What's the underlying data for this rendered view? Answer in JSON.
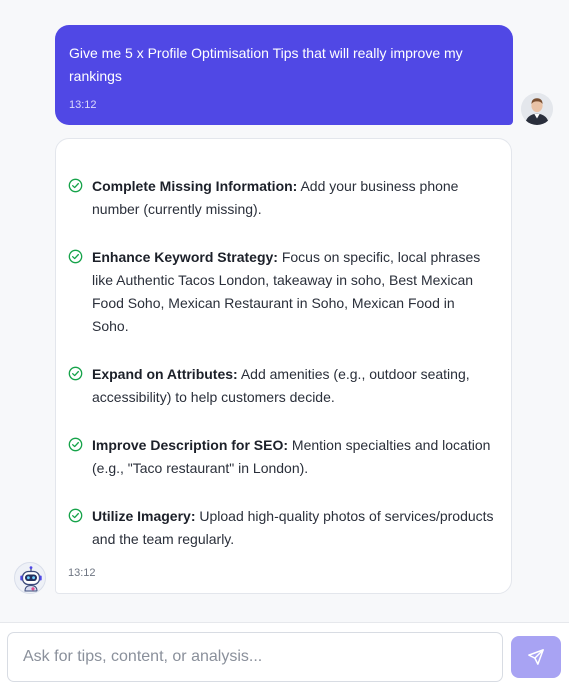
{
  "user_message": {
    "text": "Give me 5 x Profile Optimisation Tips that will really improve my rankings",
    "time": "13:12",
    "bubble_color": "#5048e5"
  },
  "assistant_message": {
    "time": "13:12",
    "check_color": "#16a34a",
    "tips": [
      {
        "title": "Complete Missing Information:",
        "text": " Add your business phone number (currently missing)."
      },
      {
        "title": "Enhance Keyword Strategy:",
        "text": " Focus on specific, local phrases like Authentic Tacos London, takeaway in soho, Best Mexican Food Soho, Mexican Restaurant in Soho, Mexican Food in Soho."
      },
      {
        "title": "Expand on Attributes:",
        "text": " Add amenities (e.g., outdoor seating, accessibility) to help customers decide."
      },
      {
        "title": "Improve Description for SEO:",
        "text": " Mention specialties and location (e.g., \"Taco restaurant\" in London)."
      },
      {
        "title": "Utilize Imagery:",
        "text": " Upload high-quality photos of services/products and the team regularly."
      }
    ]
  },
  "composer": {
    "placeholder": "Ask for tips, content, or analysis...",
    "value": "",
    "send_icon": "send-icon",
    "send_color": "#a8a3f3"
  }
}
